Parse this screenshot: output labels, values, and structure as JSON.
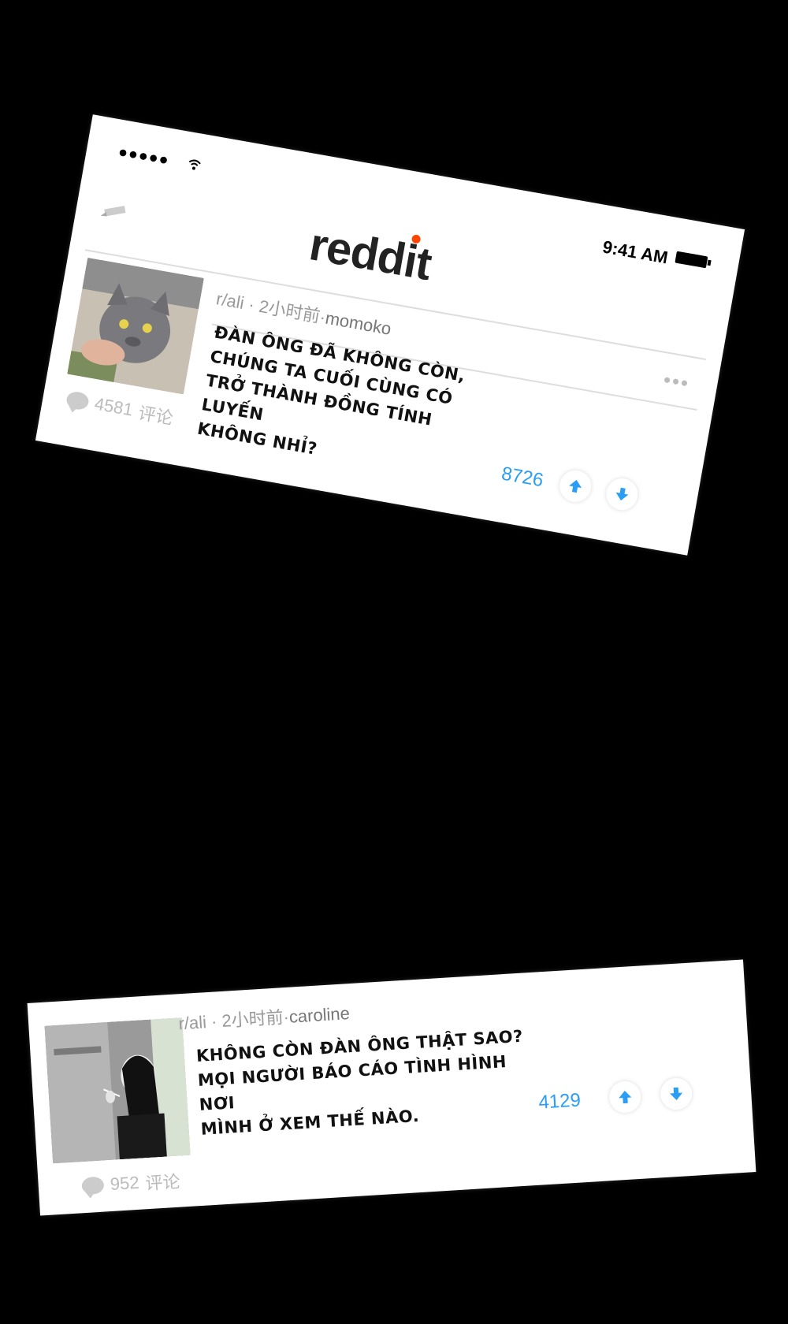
{
  "status_bar": {
    "signal": "●●●●●",
    "time": "9:41 AM"
  },
  "app": {
    "logo_text": "reddit",
    "logo_main": "redd",
    "logo_i": "i",
    "logo_t": "t"
  },
  "posts": [
    {
      "subreddit": "r/ali",
      "time_ago": "2小时前",
      "username": "momoko",
      "body": "ĐÀN ÔNG ĐÃ KHÔNG CÒN,\nCHÚNG TA CUỐI CÙNG CÓ\nTRỞ THÀNH ĐỒNG TÍNH LUYẾN\nKHÔNG NHỈ?",
      "comments_count": "4581",
      "comments_label": "评论",
      "score": "8726",
      "avatar_icon": "cat-photo"
    },
    {
      "subreddit": "r/ali",
      "time_ago": "2小时前",
      "username": "caroline",
      "body": "KHÔNG CÒN ĐÀN ÔNG THẬT SAO?\nMỌI NGƯỜI BÁO CÁO TÌNH HÌNH NƠI\nMÌNH Ở XEM THẾ NÀO.",
      "comments_count": "952",
      "comments_label": "评论",
      "score": "4129",
      "avatar_icon": "woman-smoking-photo"
    }
  ],
  "colors": {
    "accent": "#2a9df4",
    "logo_dot": "#ff4500",
    "background": "#000000"
  }
}
